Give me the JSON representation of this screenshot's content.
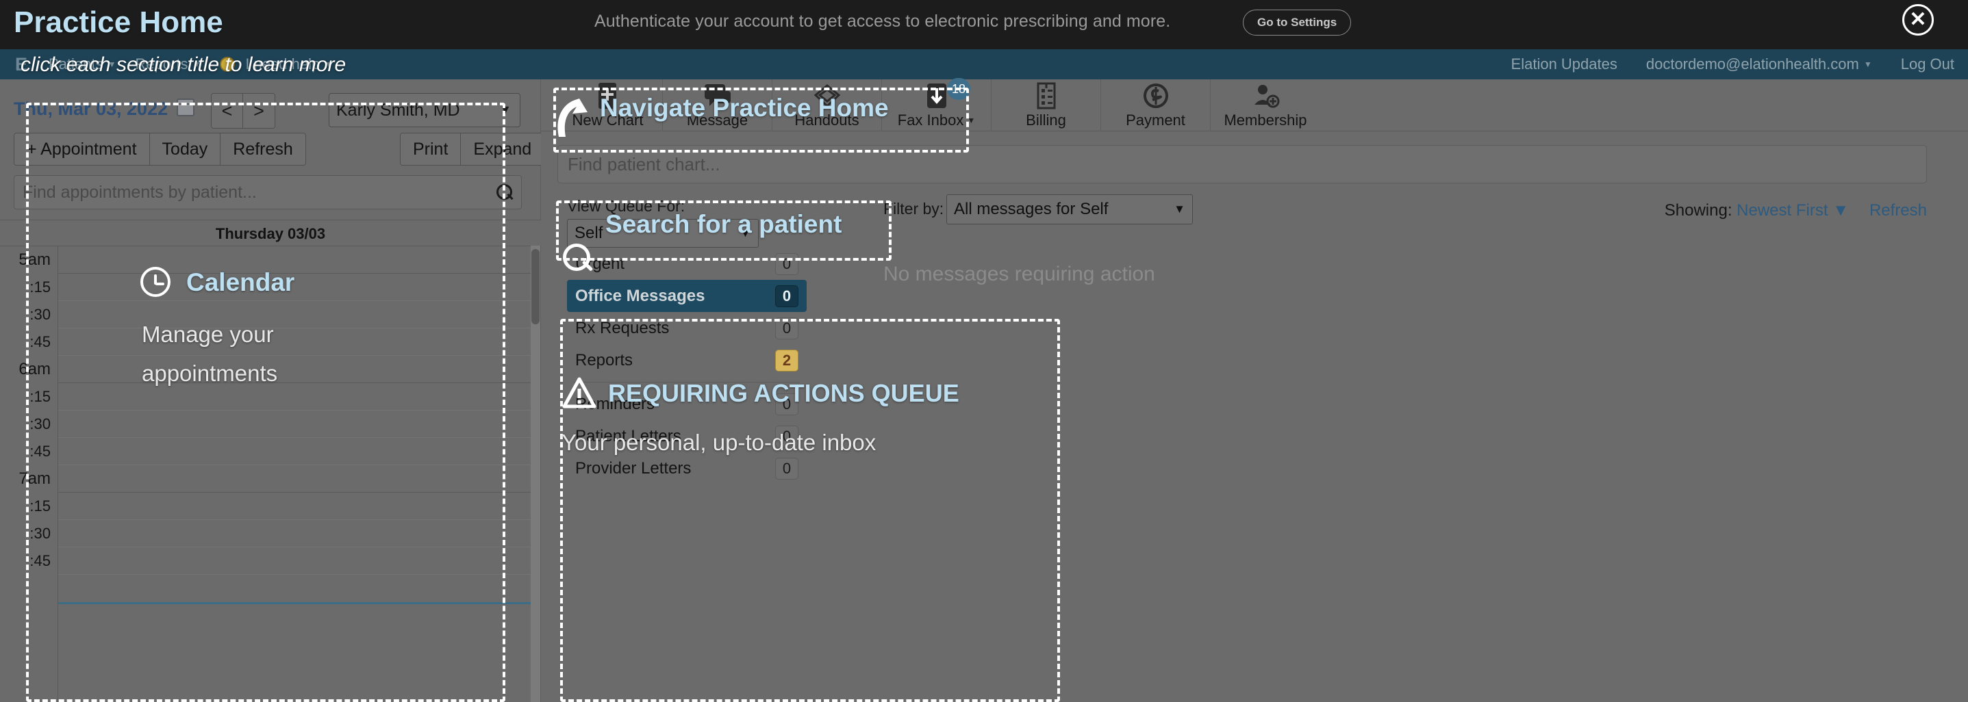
{
  "banner": {
    "message": "Authenticate your account to get access to electronic prescribing and more.",
    "settings_button": "Go to Settings",
    "close_icon": "close-icon"
  },
  "nav": {
    "logo": "E",
    "items": [
      {
        "label": "Patients",
        "caret": "▼"
      },
      {
        "label": "Reports",
        "caret": "▼"
      },
      {
        "label": "I need help",
        "caret": "▼"
      }
    ],
    "right": [
      {
        "label": "Elation Updates",
        "caret": ""
      },
      {
        "label": "doctordemo@elationhealth.com",
        "caret": "▼"
      },
      {
        "label": "Log Out",
        "caret": ""
      }
    ]
  },
  "calendar": {
    "date_label": "Thu, Mar 03, 2022",
    "prev": "<",
    "next": ">",
    "provider": "Karly Smith, MD",
    "buttons_left": [
      "+ Appointment",
      "Today",
      "Refresh"
    ],
    "buttons_right": [
      "Print",
      "Expand"
    ],
    "search_placeholder": "Find appointments by patient...",
    "search_value": "",
    "day_header": "Thursday 03/03",
    "time_labels": [
      "5am",
      ":15",
      ":30",
      ":45",
      "6am",
      ":15",
      ":30",
      ":45",
      "7am",
      ":15",
      ":30",
      ":45"
    ]
  },
  "toolbar": {
    "items": [
      {
        "label": "New Chart",
        "icon": "new-chart-icon",
        "badge": ""
      },
      {
        "label": "Message",
        "icon": "message-icon",
        "badge": ""
      },
      {
        "label": "Handouts",
        "icon": "handouts-icon",
        "badge": ""
      },
      {
        "label": "Fax Inbox",
        "icon": "fax-inbox-icon",
        "badge": "18",
        "caret": "▼"
      },
      {
        "label": "Billing",
        "icon": "billing-icon",
        "badge": ""
      },
      {
        "label": "Payment",
        "icon": "payment-icon",
        "badge": ""
      },
      {
        "label": "Membership",
        "icon": "membership-icon",
        "badge": ""
      }
    ]
  },
  "patient_search": {
    "placeholder": "Find patient chart...",
    "value": "",
    "icon": "search-icon"
  },
  "queue": {
    "view_queue_label": "View Queue For:",
    "view_queue_value": "Self",
    "filter_label": "Filter by:",
    "filter_value": "All messages for Self",
    "showing_label": "Showing:",
    "showing_value": "Newest First",
    "refresh": "Refresh",
    "empty_message": "No messages requiring action",
    "items": [
      {
        "label": "Urgent",
        "count": "0",
        "state": "normal"
      },
      {
        "label": "Office Messages",
        "count": "0",
        "state": "active"
      },
      {
        "label": "Rx Requests",
        "count": "0",
        "state": "normal"
      },
      {
        "label": "Reports",
        "count": "2",
        "state": "warn"
      },
      {
        "label": "Reminders",
        "count": "0",
        "state": "normal"
      },
      {
        "label": "Patient Letters",
        "count": "0",
        "state": "normal"
      },
      {
        "label": "Provider Letters",
        "count": "0",
        "state": "normal"
      }
    ]
  },
  "coachmarks": {
    "page_title": "Practice Home",
    "hint": "click each section title to learn more",
    "calendar_title": "Calendar",
    "calendar_sub_line1": "Manage your",
    "calendar_sub_line2": "appointments",
    "navigate_title": "Navigate Practice Home",
    "search_title": "Search for a patient",
    "queue_title": "REQUIRING ACTIONS QUEUE",
    "queue_sub": "Your personal, up-to-date inbox"
  },
  "colors": {
    "accent_blue": "#bcdff2",
    "nav_bg": "#1f4356",
    "banner_bg": "#1c1c1c",
    "active_row": "#1e4a61",
    "warn_badge": "#d9b75c"
  }
}
